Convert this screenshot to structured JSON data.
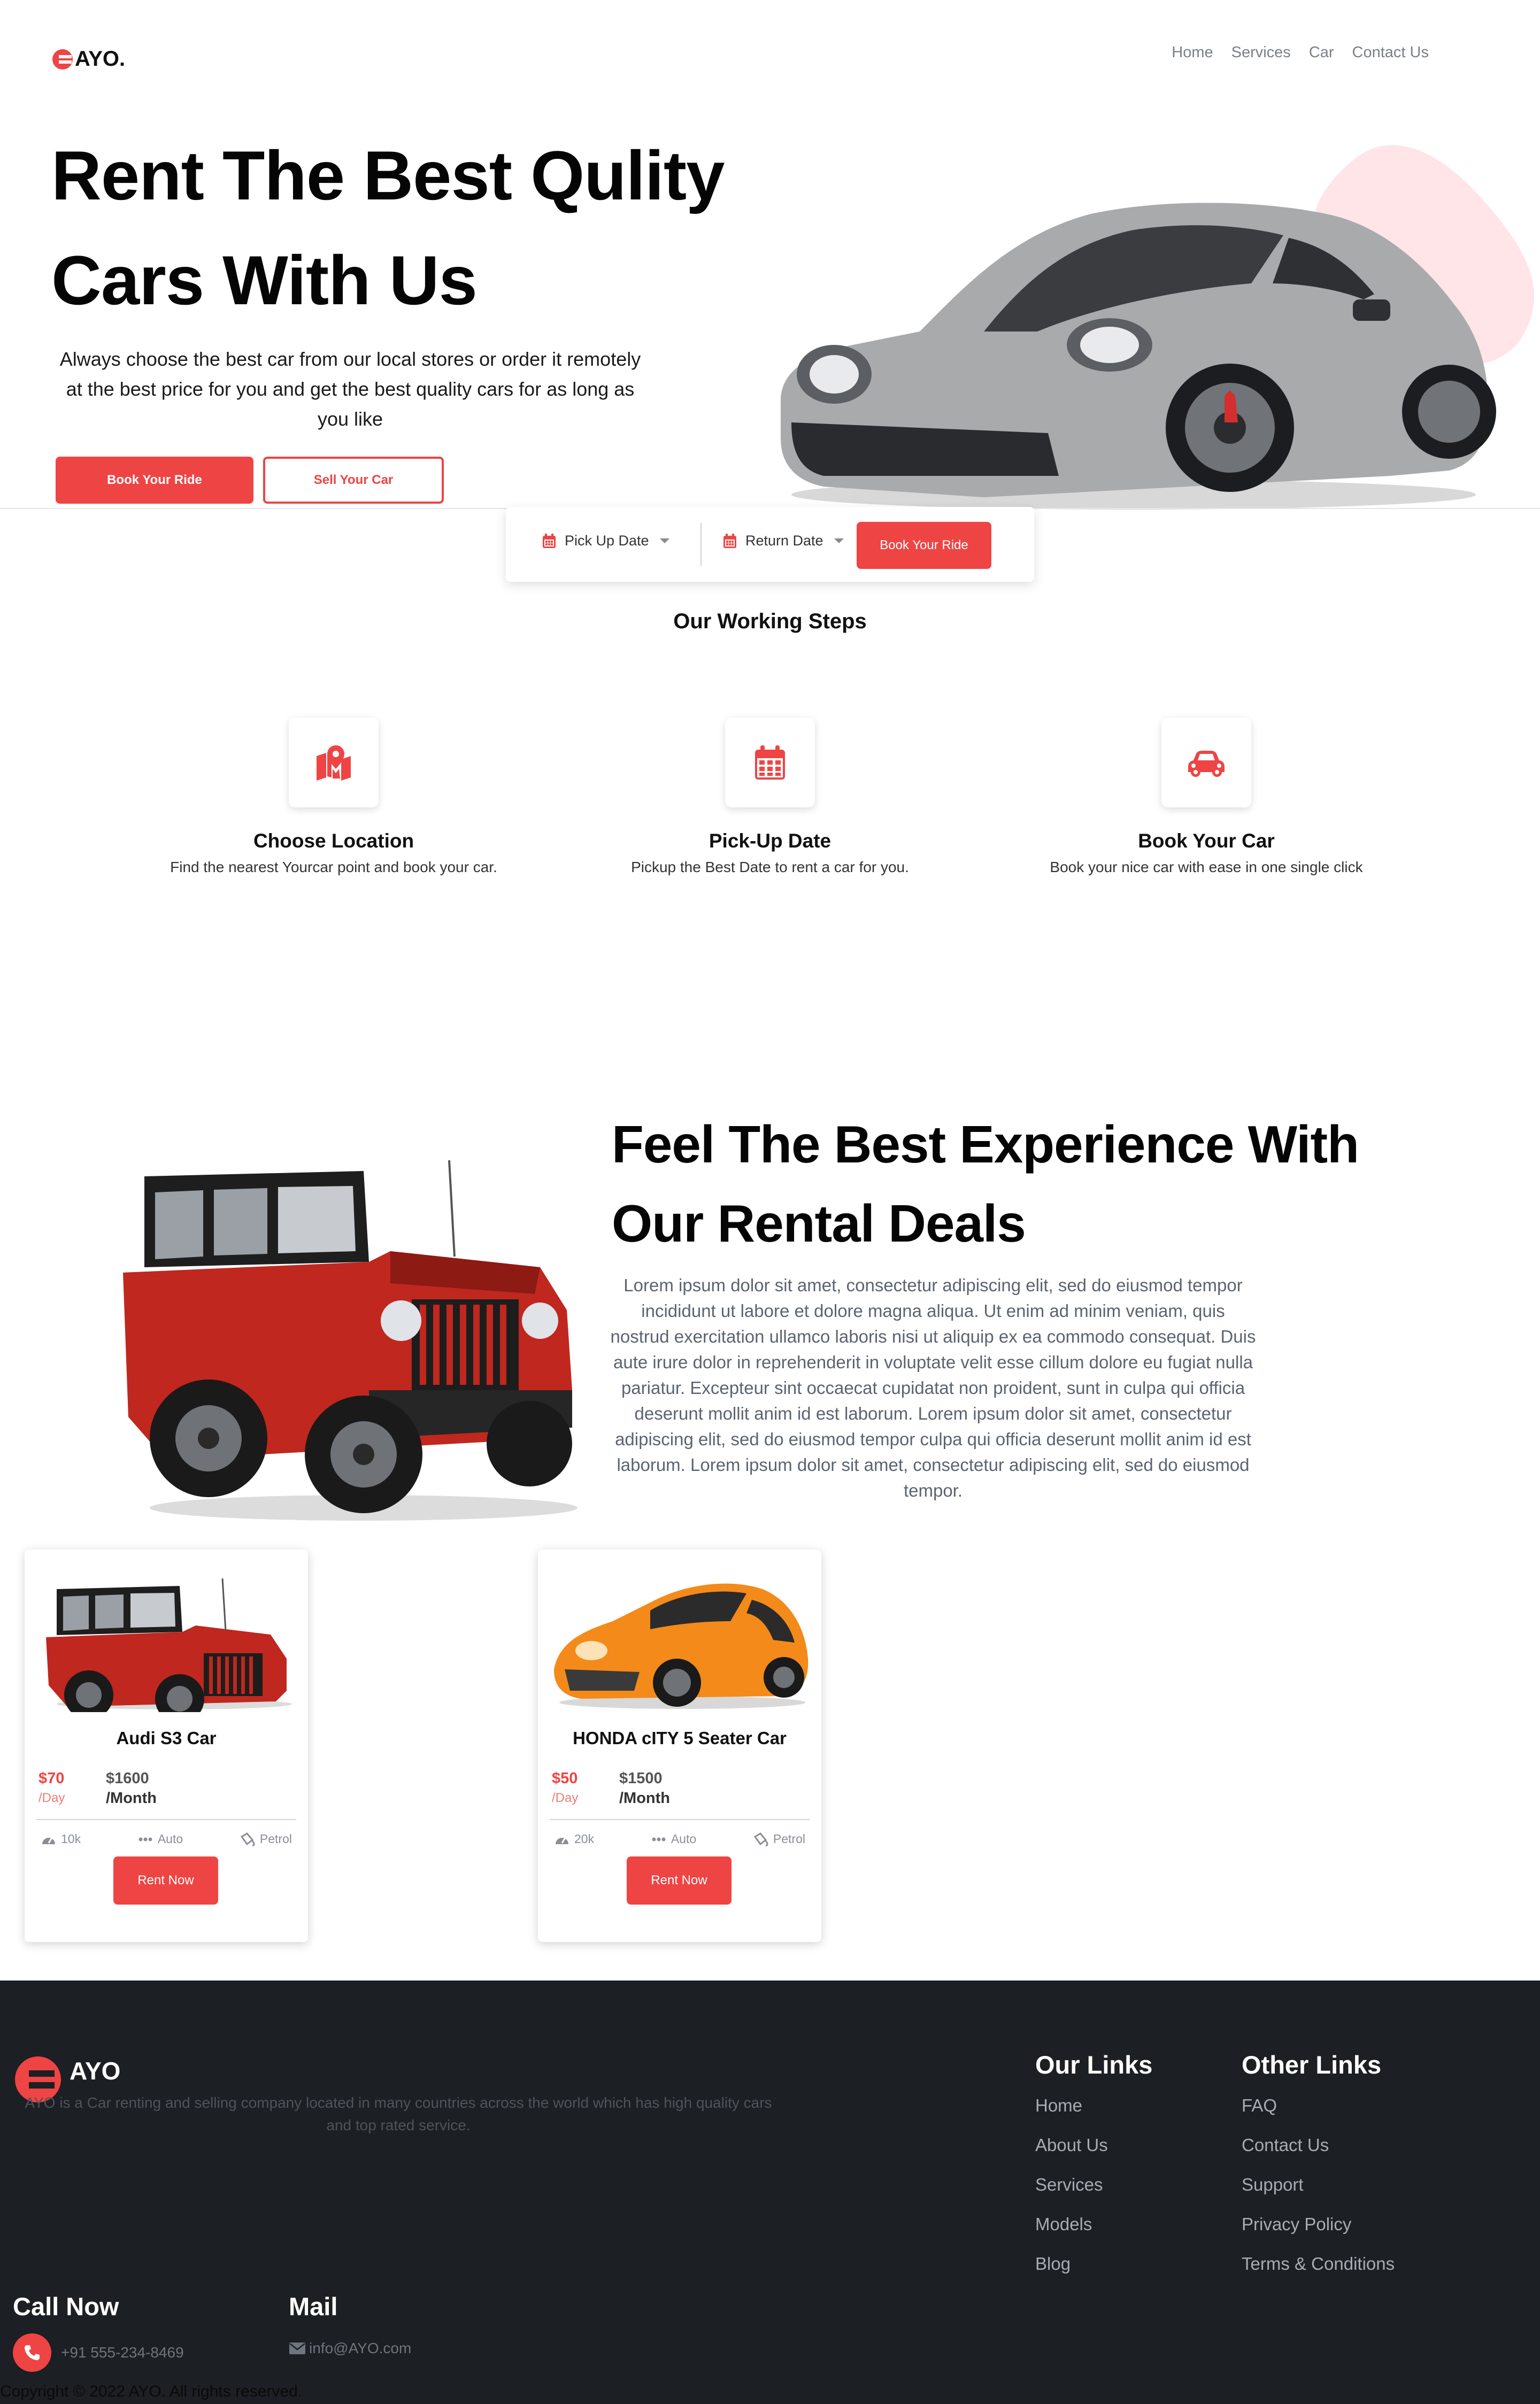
{
  "brand": {
    "name": "AYO.",
    "footer_name": "AYO",
    "accent": "#ef4444"
  },
  "nav": {
    "items": [
      {
        "label": "Home"
      },
      {
        "label": "Services"
      },
      {
        "label": "Car"
      },
      {
        "label": "Contact Us"
      }
    ]
  },
  "hero": {
    "title_line1": "Rent The Best Qulity",
    "title_line2": "Cars With Us",
    "subtitle": "Always choose the best car from our local stores or order it remotely at the best price for you and get the best quality cars for as long as you like",
    "primary_button": "Book Your Ride",
    "secondary_button": "Sell Your Car"
  },
  "booking": {
    "pickup_label": "Pick Up Date",
    "return_label": "Return Date",
    "button": "Book Your Ride"
  },
  "steps": {
    "title": "Our Working Steps",
    "items": [
      {
        "icon": "map-location-icon",
        "title": "Choose Location",
        "desc": "Find the nearest Yourcar point and book your car."
      },
      {
        "icon": "calendar-icon",
        "title": "Pick-Up Date",
        "desc": "Pickup the Best Date to rent a car for you."
      },
      {
        "icon": "car-icon",
        "title": "Book Your Car",
        "desc": "Book your nice car with ease in one single click"
      }
    ]
  },
  "experience": {
    "title_line1": "Feel The Best Experience With",
    "title_line2": "Our Rental Deals",
    "body": "Lorem ipsum dolor sit amet, consectetur adipiscing elit, sed do eiusmod tempor incididunt ut labore et dolore magna aliqua. Ut enim ad minim veniam, quis nostrud exercitation ullamco laboris nisi ut aliquip ex ea commodo consequat. Duis aute irure dolor in reprehenderit in voluptate velit esse cillum dolore eu fugiat nulla pariatur. Excepteur sint occaecat cupidatat non proident, sunt in culpa qui officia deserunt mollit anim id est laborum. Lorem ipsum dolor sit amet, consectetur adipiscing elit, sed do eiusmod tempor culpa qui officia deserunt mollit anim id est laborum. Lorem ipsum dolor sit amet, consectetur adipiscing elit, sed do eiusmod tempor."
  },
  "cars": [
    {
      "name": "Audi S3 Car",
      "price_day": "$70",
      "per_day": "/Day",
      "price_month": "$1600",
      "per_month": "/Month",
      "mileage": "10k",
      "transmission": "Auto",
      "fuel": "Petrol",
      "button": "Rent Now"
    },
    {
      "name": "HONDA cITY 5 Seater Car",
      "price_day": "$50",
      "per_day": "/Day",
      "price_month": "$1500",
      "per_month": "/Month",
      "mileage": "20k",
      "transmission": "Auto",
      "fuel": "Petrol",
      "button": "Rent Now"
    }
  ],
  "footer": {
    "description": "AYO is a Car renting and selling company located in many countries across the world which has high quality cars and top rated service.",
    "our_links_title": "Our Links",
    "our_links": [
      "Home",
      "About Us",
      "Services",
      "Models",
      "Blog"
    ],
    "other_links_title": "Other Links",
    "other_links": [
      "FAQ",
      "Contact Us",
      "Support",
      "Privacy Policy",
      "Terms & Conditions"
    ],
    "call_title": "Call Now",
    "phone": "+91 555-234-8469",
    "mail_title": "Mail",
    "email": "info@AYO.com",
    "copyright": "Copyright © 2022 AYO. All rights reserved."
  }
}
